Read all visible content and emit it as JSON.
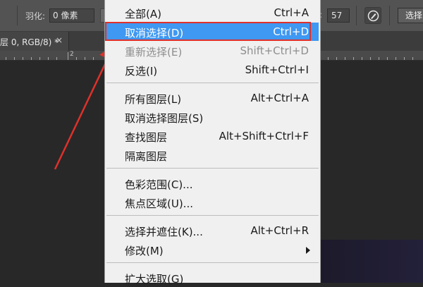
{
  "options_bar": {
    "feather_label": "羽化:",
    "feather_value": "0 像素",
    "tolerance_value": "57",
    "select_button": "选择",
    "pen_icon": "pen-pressure-icon"
  },
  "document_tab": {
    "title": "层 0, RGB/8) *",
    "close": "×"
  },
  "ruler": {
    "label": "2"
  },
  "menu": {
    "items": [
      {
        "label": "全部(A)",
        "shortcut": "Ctrl+A"
      },
      {
        "label": "取消选择(D)",
        "shortcut": "Ctrl+D",
        "state": "highlighted"
      },
      {
        "label": "重新选择(E)",
        "shortcut": "Shift+Ctrl+D",
        "state": "disabled"
      },
      {
        "label": "反选(I)",
        "shortcut": "Shift+Ctrl+I"
      },
      {
        "label": "所有图层(L)",
        "shortcut": "Alt+Ctrl+A"
      },
      {
        "label": "取消选择图层(S)",
        "shortcut": ""
      },
      {
        "label": "查找图层",
        "shortcut": "Alt+Shift+Ctrl+F"
      },
      {
        "label": "隔离图层",
        "shortcut": ""
      },
      {
        "label": "色彩范围(C)...",
        "shortcut": ""
      },
      {
        "label": "焦点区域(U)...",
        "shortcut": ""
      },
      {
        "label": "选择并遮住(K)...",
        "shortcut": "Alt+Ctrl+R"
      },
      {
        "label": "修改(M)",
        "shortcut": "",
        "submenu": true
      },
      {
        "label": "扩大选取(G)",
        "shortcut": ""
      }
    ]
  },
  "annotation": {
    "highlight_color": "#e0302a",
    "selection_color": "#3f98f1"
  }
}
